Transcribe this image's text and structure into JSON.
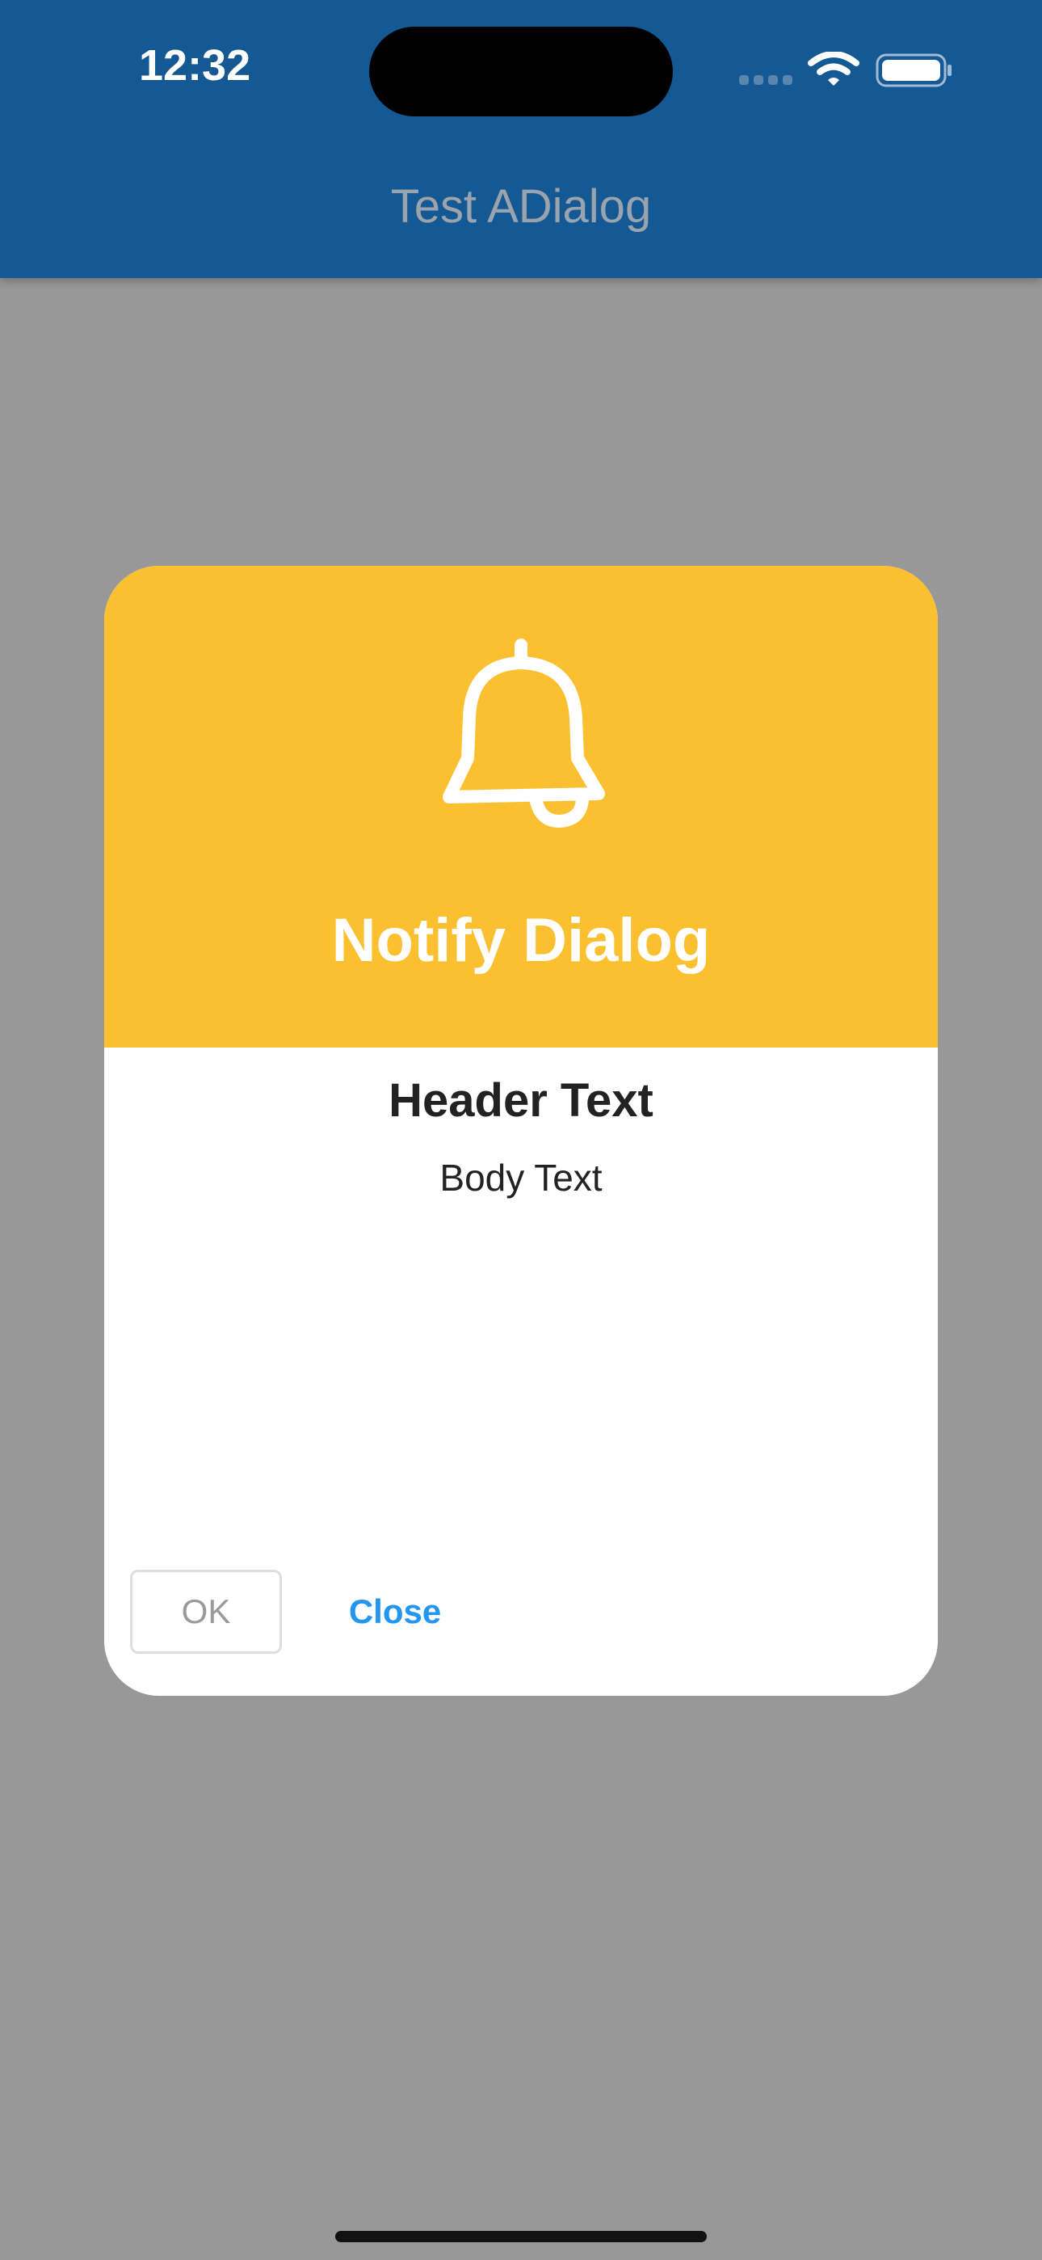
{
  "status_bar": {
    "time": "12:32"
  },
  "app_bar": {
    "title": "Test ADialog",
    "color": "#145993"
  },
  "dialog": {
    "title": "Notify Dialog",
    "icon": "bell-icon",
    "header_color": "#fbc02f",
    "header_text": "Header Text",
    "body_text": "Body Text",
    "buttons": {
      "ok_label": "OK",
      "close_label": "Close"
    },
    "accent_color": "#2196f3"
  }
}
